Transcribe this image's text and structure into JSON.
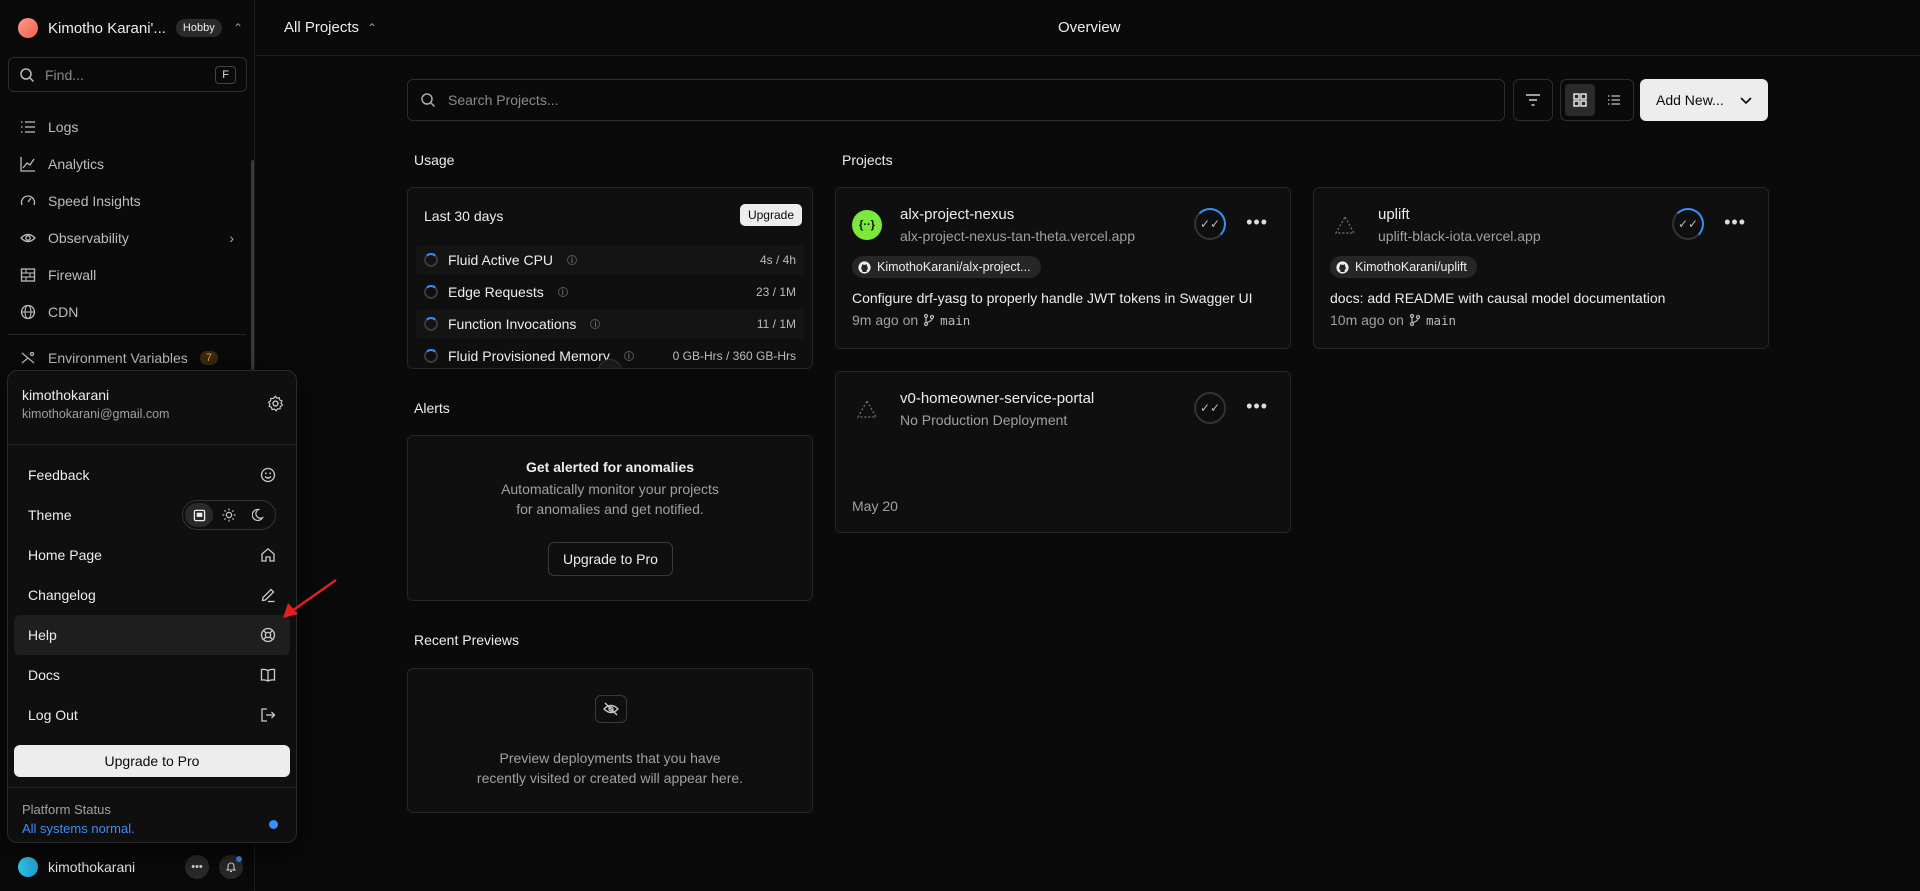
{
  "sidebar": {
    "team_name": "Kimotho Karani'...",
    "plan_badge": "Hobby",
    "find_placeholder": "Find...",
    "find_shortcut": "F",
    "nav": [
      {
        "label": "Logs",
        "icon": "logs-icon"
      },
      {
        "label": "Analytics",
        "icon": "analytics-icon"
      },
      {
        "label": "Speed Insights",
        "icon": "speed-insights-icon"
      },
      {
        "label": "Observability",
        "icon": "eye-icon"
      },
      {
        "label": "Firewall",
        "icon": "firewall-icon"
      },
      {
        "label": "CDN",
        "icon": "globe-icon"
      },
      {
        "label": "Environment Variables",
        "icon": "env-icon",
        "count": "7"
      }
    ],
    "footer_user": "kimothokarani"
  },
  "menu": {
    "username": "kimothokarani",
    "email": "kimothokarani@gmail.com",
    "items": [
      {
        "label": "Feedback",
        "icon": "smiley-icon"
      },
      {
        "label": "Theme",
        "icon": "theme-switch"
      },
      {
        "label": "Home Page",
        "icon": "home-icon"
      },
      {
        "label": "Changelog",
        "icon": "pencil-icon"
      },
      {
        "label": "Help",
        "icon": "help-icon"
      },
      {
        "label": "Docs",
        "icon": "book-icon"
      },
      {
        "label": "Log Out",
        "icon": "logout-icon"
      }
    ],
    "upgrade": "Upgrade to Pro",
    "status_title": "Platform Status",
    "status_value": "All systems normal.",
    "status_color": "#3b8ef7"
  },
  "topbar": {
    "scope": "All Projects",
    "title": "Overview"
  },
  "search": {
    "placeholder": "Search Projects..."
  },
  "add_new": "Add New...",
  "usage": {
    "title": "Usage",
    "period": "Last 30 days",
    "upgrade": "Upgrade",
    "rows": [
      {
        "label": "Fluid Active CPU",
        "value": "4s / 4h"
      },
      {
        "label": "Edge Requests",
        "value": "23 / 1M"
      },
      {
        "label": "Function Invocations",
        "value": "11 / 1M"
      },
      {
        "label": "Fluid Provisioned Memory",
        "value": "0 GB-Hrs / 360 GB-Hrs"
      }
    ]
  },
  "alerts": {
    "title": "Alerts",
    "heading": "Get alerted for anomalies",
    "line1": "Automatically monitor your projects",
    "line2": "for anomalies and get notified.",
    "button": "Upgrade to Pro"
  },
  "previews": {
    "title": "Recent Previews",
    "line1": "Preview deployments that you have",
    "line2": "recently visited or created will appear here."
  },
  "projects": {
    "title": "Projects",
    "items": [
      {
        "name": "alx-project-nexus",
        "url": "alx-project-nexus-tan-theta.vercel.app",
        "repo": "KimothoKarani/alx-project...",
        "message": "Configure drf-yasg to properly handle JWT tokens in Swagger UI",
        "time": "9m ago on",
        "branch": "main"
      },
      {
        "name": "uplift",
        "url": "uplift-black-iota.vercel.app",
        "repo": "KimothoKarani/uplift",
        "message": "docs: add README with causal model documentation",
        "time": "10m ago on",
        "branch": "main"
      },
      {
        "name": "v0-homeowner-service-portal",
        "url": "No Production Deployment",
        "date": "May 20"
      }
    ]
  }
}
